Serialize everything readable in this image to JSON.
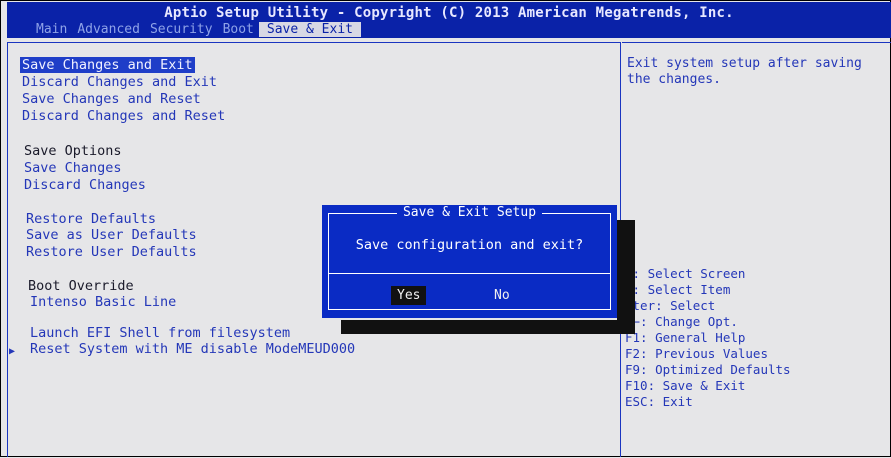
{
  "header": {
    "title": "Aptio Setup Utility - Copyright (C) 2013 American Megatrends, Inc.",
    "tabs": [
      "Main",
      "Advanced",
      "Security",
      "Boot",
      "Save & Exit"
    ],
    "active_tab": "Save & Exit"
  },
  "menu": {
    "save_changes_and_exit": "Save Changes and Exit",
    "discard_changes_and_exit": "Discard Changes and Exit",
    "save_changes_and_reset": "Save Changes and Reset",
    "discard_changes_and_reset": "Discard Changes and Reset",
    "save_options": "Save Options",
    "save_changes": "Save Changes",
    "discard_changes": "Discard Changes",
    "restore_defaults": "Restore Defaults",
    "save_user_defaults": "Save as User Defaults",
    "restore_user_defaults": "Restore User Defaults",
    "boot_override": "Boot Override",
    "intenso": "Intenso Basic Line",
    "launch_efi": "Launch EFI Shell from filesystem",
    "reset_system": "Reset System with ME disable ModeMEUD000"
  },
  "help_text": "Exit system setup after saving the changes.",
  "keys": [
    "←: Select Screen",
    "↓: Select Item",
    "nter: Select",
    "/−: Change Opt.",
    "F1: General Help",
    "F2: Previous Values",
    "F9: Optimized Defaults",
    "F10: Save & Exit",
    "ESC: Exit"
  ],
  "dialog": {
    "title": "Save & Exit Setup",
    "question": "Save configuration and exit?",
    "yes": "Yes",
    "no": "No"
  },
  "colors": {
    "header_bg": "#0a22a8",
    "dialog_bg": "#0a2bc4",
    "text_blue": "#2437b8",
    "background": "#e6e6e8"
  }
}
